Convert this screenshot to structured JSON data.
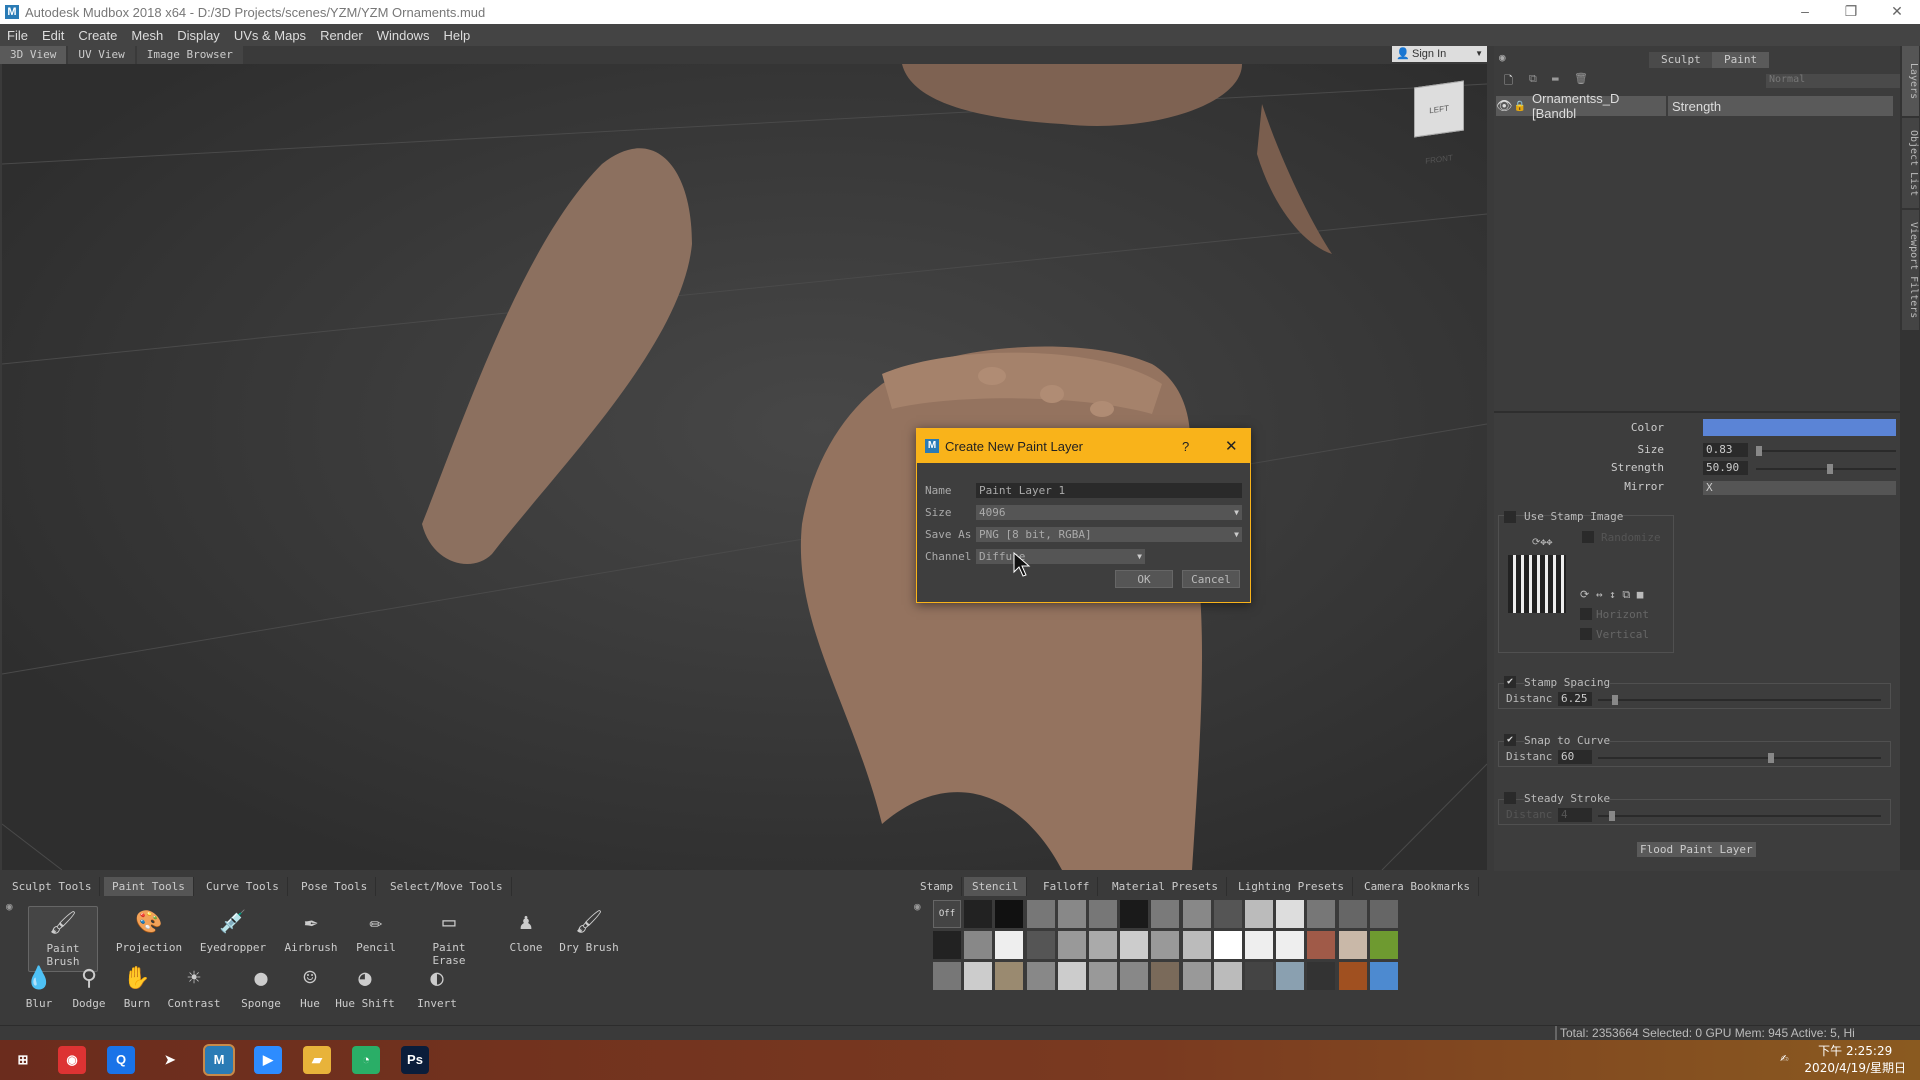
{
  "window": {
    "title": "Autodesk Mudbox 2018 x64 - D:/3D Projects/scenes/YZM/YZM Ornaments.mud",
    "logo": "M",
    "minimize": "–",
    "restore": "❐",
    "close": "✕"
  },
  "menu": [
    "File",
    "Edit",
    "Create",
    "Mesh",
    "Display",
    "UVs & Maps",
    "Render",
    "Windows",
    "Help"
  ],
  "view_tabs": [
    {
      "label": "3D View",
      "active": true
    },
    {
      "label": "UV View"
    },
    {
      "label": "Image Browser"
    }
  ],
  "signin": {
    "label": "Sign In"
  },
  "viewcube": {
    "left": "LEFT",
    "front": "FRONT"
  },
  "right_panel": {
    "mode_tabs": [
      {
        "label": "Sculpt"
      },
      {
        "label": "Paint",
        "active": true
      }
    ],
    "blend_mode": "Normal",
    "layer": {
      "name": "Ornamentss_D [Bandbl",
      "strength": "Strength"
    },
    "side_tabs": [
      "Layers",
      "Object List",
      "Viewport Filters"
    ],
    "props": {
      "color_label": "Color",
      "color_value": "#5b84d6",
      "size_label": "Size",
      "size_value": "0.83",
      "size_fraction": 0.0,
      "strength_label": "Strength",
      "strength_value": "50.90",
      "strength_fraction": 0.51,
      "mirror_label": "Mirror",
      "mirror_value": "X",
      "use_stamp_label": "Use Stamp Image",
      "use_stamp_checked": false,
      "randomize_label": "Randomize",
      "horizontal_label": "Horizont",
      "vertical_label": "Vertical",
      "stamp_spacing_label": "Stamp Spacing",
      "stamp_spacing_checked": true,
      "stamp_spacing_distance_label": "Distanc",
      "stamp_spacing_distance": "6.25",
      "stamp_spacing_fraction": 0.05,
      "snap_label": "Snap to Curve",
      "snap_checked": true,
      "snap_distance_label": "Distanc",
      "snap_distance": "60",
      "snap_fraction": 0.6,
      "steady_label": "Steady Stroke",
      "steady_checked": false,
      "steady_distance_label": "Distanc",
      "steady_distance": "4",
      "steady_fraction": 0.04,
      "flood_label": "Flood Paint Layer"
    }
  },
  "dialog": {
    "title": "Create New Paint Layer",
    "help": "?",
    "close": "✕",
    "name_label": "Name",
    "name_value": "Paint Layer 1",
    "size_label": "Size",
    "size_value": "4096",
    "save_label": "Save As",
    "save_value": "PNG [8 bit, RGBA]",
    "channel_label": "Channel",
    "channel_value": "Diffuse",
    "ok": "OK",
    "cancel": "Cancel"
  },
  "tool_tabs": [
    {
      "label": "Sculpt Tools"
    },
    {
      "label": "Paint Tools",
      "active": true
    },
    {
      "label": "Curve Tools"
    },
    {
      "label": "Pose Tools"
    },
    {
      "label": "Select/Move Tools"
    }
  ],
  "tools_row1": [
    {
      "label": "Paint Brush",
      "icon": "🖌",
      "selected": true
    },
    {
      "label": "Projection",
      "icon": "🎨"
    },
    {
      "label": "Eyedropper",
      "icon": "💉"
    },
    {
      "label": "Airbrush",
      "icon": "✒"
    },
    {
      "label": "Pencil",
      "icon": "✏"
    },
    {
      "label": "Paint Erase",
      "icon": "▭"
    },
    {
      "label": "Clone",
      "icon": "♟"
    },
    {
      "label": "Dry Brush",
      "icon": "🖌"
    }
  ],
  "tools_row2": [
    {
      "label": "Blur",
      "icon": "💧"
    },
    {
      "label": "Dodge",
      "icon": "⚲"
    },
    {
      "label": "Burn",
      "icon": "✋"
    },
    {
      "label": "Contrast",
      "icon": "☀"
    },
    {
      "label": "Sponge",
      "icon": "●"
    },
    {
      "label": "Hue",
      "icon": "☺"
    },
    {
      "label": "Hue Shift",
      "icon": "◕"
    },
    {
      "label": "Invert",
      "icon": "◐"
    }
  ],
  "tray_tabs": [
    {
      "label": "Stamp"
    },
    {
      "label": "Stencil",
      "active": true
    },
    {
      "label": "Falloff"
    },
    {
      "label": "Material Presets"
    },
    {
      "label": "Lighting Presets"
    },
    {
      "label": "Camera Bookmarks"
    }
  ],
  "stencil_off": "Off",
  "stencils": [
    [
      "#000",
      "#222",
      "#111",
      "#777",
      "#888",
      "#777",
      "#1a1a1a",
      "#7a7a7a",
      "#888",
      "#555",
      "#bbb",
      "#ddd",
      "#777",
      "#666",
      "#666"
    ],
    [
      "#222",
      "#888",
      "#eee",
      "#555",
      "#999",
      "#aaa",
      "#ccc",
      "#999",
      "#bbb",
      "#fff",
      "#eee",
      "#eee",
      "#a05a48",
      "#c9b8a8",
      "#6e9a30"
    ],
    [
      "#777",
      "#ccc",
      "#9a8a70",
      "#888",
      "#ccc",
      "#999",
      "#888",
      "#7a6a5a",
      "#999",
      "#bbb",
      "#444",
      "#8aa0b0",
      "#333",
      "#a05020",
      "#4d8ad0"
    ]
  ],
  "status": "Total: 2353664  Selected: 0 GPU Mem: 945  Active: 5, Hi",
  "taskbar": {
    "apps": [
      {
        "name": "start",
        "glyph": "⊞",
        "color": "transparent"
      },
      {
        "name": "chrome",
        "glyph": "◉",
        "color": "#d33"
      },
      {
        "name": "browser",
        "glyph": "Q",
        "color": "#1a73e8"
      },
      {
        "name": "app",
        "glyph": "➤",
        "color": "transparent"
      },
      {
        "name": "mudbox",
        "glyph": "M",
        "color": "#2a7bb5"
      },
      {
        "name": "zoom",
        "glyph": "▶",
        "color": "#2d8cff"
      },
      {
        "name": "explorer",
        "glyph": "▰",
        "color": "#e8b33a"
      },
      {
        "name": "wechat",
        "glyph": "◔",
        "color": "#2aae67"
      },
      {
        "name": "photoshop",
        "glyph": "Ps",
        "color": "#0b1d3a"
      }
    ],
    "time": "下午 2:25:29",
    "date": "2020/4/19/星期日"
  }
}
